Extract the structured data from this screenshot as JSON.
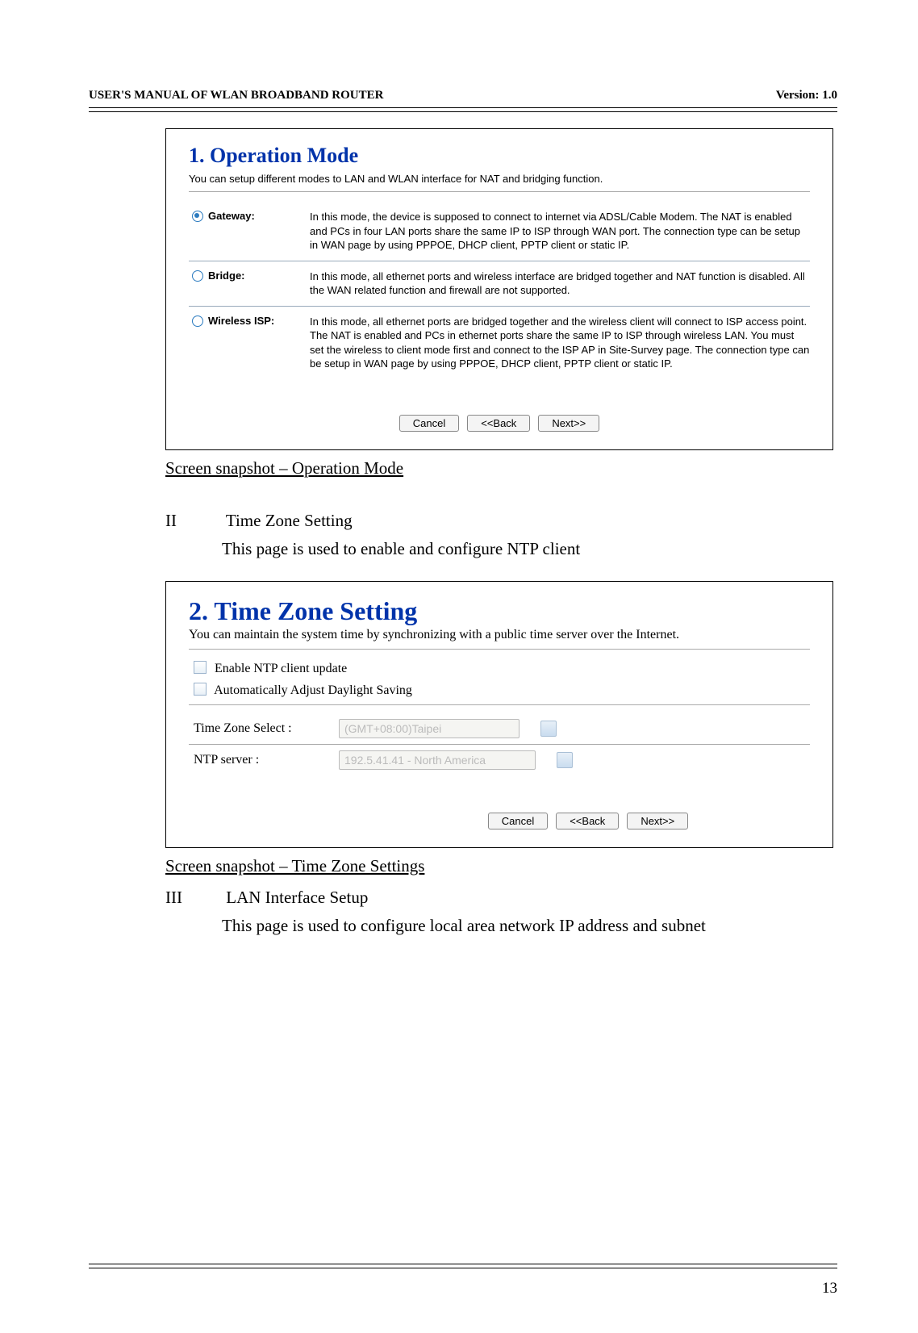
{
  "header": {
    "left": "USER'S MANUAL OF WLAN BROADBAND ROUTER",
    "right": "Version: 1.0"
  },
  "panel1": {
    "title": "1. Operation Mode",
    "subdesc": "You can setup different modes to LAN and WLAN interface for NAT and bridging function.",
    "options": [
      {
        "name": "Gateway:",
        "selected": true,
        "desc": "In this mode, the device is supposed to connect to internet via ADSL/Cable Modem. The NAT is enabled and PCs in four LAN ports share the same IP to ISP through WAN port. The connection type can be setup in WAN page by using PPPOE, DHCP client, PPTP client or static IP."
      },
      {
        "name": "Bridge:",
        "selected": false,
        "desc": "In this mode, all ethernet ports and wireless interface are bridged together and NAT function is disabled. All the WAN related function and firewall are not supported."
      },
      {
        "name": "Wireless ISP:",
        "selected": false,
        "desc": "In this mode, all ethernet ports are bridged together and the wireless client will connect to ISP access point. The NAT is enabled and PCs in ethernet ports share the same IP to ISP through wireless LAN. You must set the wireless to client mode first and connect to the ISP AP in Site-Survey page. The connection type can be setup in WAN page by using PPPOE, DHCP client, PPTP client or static IP."
      }
    ],
    "buttons": {
      "cancel": "Cancel",
      "back": "<<Back",
      "next": "Next>>"
    }
  },
  "caption1": "Screen snapshot – Operation Mode",
  "sectionII": {
    "roman": "II",
    "title": "Time Zone Setting",
    "body": "This page is used to enable and configure NTP client"
  },
  "panel2": {
    "title": "2. Time Zone Setting",
    "subdesc": "You can maintain the system time by synchronizing with a public time server over the Internet.",
    "chk1": "Enable NTP client update",
    "chk2": "Automatically Adjust Daylight Saving",
    "tz_label": "Time Zone Select :",
    "tz_value": "(GMT+08:00)Taipei",
    "ntp_label": "NTP server :",
    "ntp_value": "192.5.41.41 - North America",
    "buttons": {
      "cancel": "Cancel",
      "back": "<<Back",
      "next": "Next>>"
    }
  },
  "caption2": "Screen snapshot – Time Zone Settings",
  "sectionIII": {
    "roman": "III",
    "title": "LAN Interface Setup",
    "body": "This page is used to configure local area network IP address and subnet"
  },
  "pagenum": "13"
}
